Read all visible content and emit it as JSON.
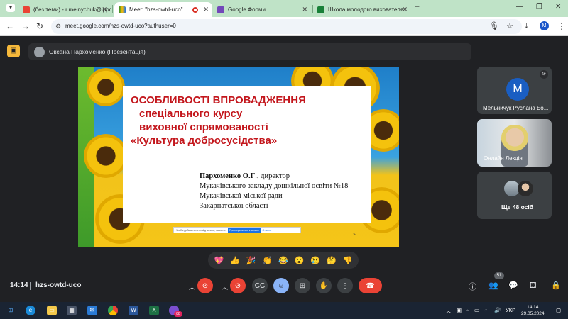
{
  "browser": {
    "tabs": [
      {
        "label": "(без теми) - r.melnychuk@ippo",
        "icon": "gmail-icon",
        "active": false
      },
      {
        "label": "Meet: \"hzs-owtd-uco\"",
        "icon": "meet-icon",
        "active": true
      },
      {
        "label": "Google Форми",
        "icon": "forms-icon",
        "active": false
      },
      {
        "label": "Школа молодого вихователя",
        "icon": "sheets-icon",
        "active": false
      }
    ],
    "new_tab": "+",
    "url": "meet.google.com/hzs-owtd-uco?authuser=0",
    "profile_initial": "M"
  },
  "meet": {
    "presenter_label": "Оксана Пархоменко (Презентація)",
    "slide": {
      "title_lines": [
        "ОСОБЛИВОСТІ ВПРОВАДЖЕННЯ",
        "спеціального курсу",
        "виховної спрямованості",
        "«Культура добросусідства»"
      ],
      "author_name": "Пархоменко О.Г",
      "author_role": "., директор",
      "author_lines": [
        "Мукачівського закладу дошкільної освіти №18",
        "Мукачівської міської ради",
        "Закарпатської області"
      ],
      "bar_text": "Чтобы добавить на слайд запись, нажмите",
      "bar_button": "Присоединиться к записи",
      "bar_link": "Отмена"
    },
    "participants": [
      {
        "name": "Мельничук Руслана Бо...",
        "initial": "M"
      },
      {
        "name": "Онлайн Лекція"
      },
      {
        "name": "Ще 48 осіб"
      }
    ],
    "reactions": [
      "💖",
      "👍",
      "🎉",
      "👏",
      "😂",
      "😮",
      "😢",
      "🤔",
      "👎"
    ],
    "time": "14:14",
    "meeting_code": "hzs-owtd-uco",
    "people_count": "51",
    "colors": {
      "leave": "#ea4335",
      "background": "#202124",
      "accent": "#1a5ec2"
    }
  },
  "taskbar": {
    "language": "УКР",
    "time": "14:14",
    "date": "29.05.2024",
    "notification_count": "88"
  }
}
